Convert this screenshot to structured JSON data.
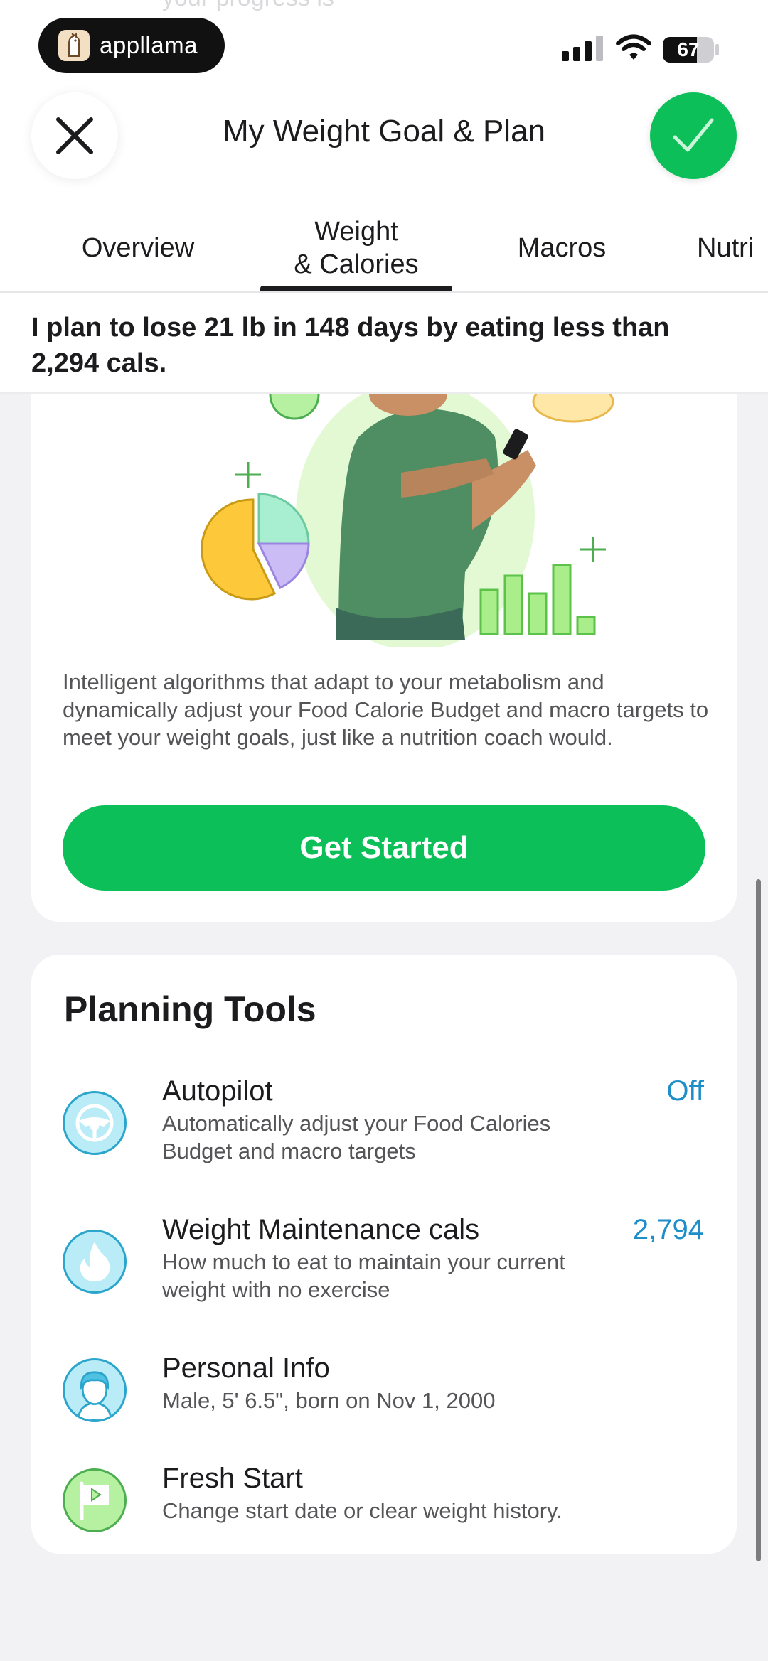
{
  "status_bar": {
    "app_name": "appllama",
    "battery": "67",
    "battery_fraction": 0.67
  },
  "header": {
    "ghost_text": "your progress is",
    "title": "My Weight Goal & Plan"
  },
  "tabs": [
    {
      "label_line1": "Overview",
      "label_line2": ""
    },
    {
      "label_line1": "Weight",
      "label_line2": "& Calories"
    },
    {
      "label_line1": "Macros",
      "label_line2": ""
    },
    {
      "label_line1": "Nutri",
      "label_line2": ""
    }
  ],
  "active_tab_index": 1,
  "plan_summary": "I plan to lose 21 lb in 148 days by eating less than 2,294 cals.",
  "intro_card": {
    "description": "Intelligent algorithms that adapt to your metabolism and dynamically adjust your Food Calorie Budget and macro targets to meet your weight goals, just like a nutrition coach would.",
    "cta_label": "Get Started"
  },
  "planning_tools": {
    "title": "Planning Tools",
    "items": [
      {
        "title": "Autopilot",
        "subtitle": "Automatically adjust your Food Calories Budget and macro targets",
        "value": "Off",
        "icon": "steering-wheel-icon"
      },
      {
        "title": "Weight Maintenance cals",
        "subtitle": "How much to eat to maintain your current weight with no exercise",
        "value": "2,794",
        "icon": "flame-icon"
      },
      {
        "title": "Personal Info",
        "subtitle": "Male, 5' 6.5\", born on Nov 1, 2000",
        "value": "",
        "icon": "person-icon"
      },
      {
        "title": "Fresh Start",
        "subtitle": "Change start date or clear weight history.",
        "value": "",
        "icon": "flag-icon"
      }
    ]
  },
  "colors": {
    "accent_green": "#0cbf59",
    "value_blue": "#1d8ec8",
    "icon_blue_fill": "#b9ecf7",
    "icon_blue_stroke": "#2ba5cc",
    "icon_green_fill": "#b6f0a1",
    "icon_green_stroke": "#4cae4f"
  }
}
